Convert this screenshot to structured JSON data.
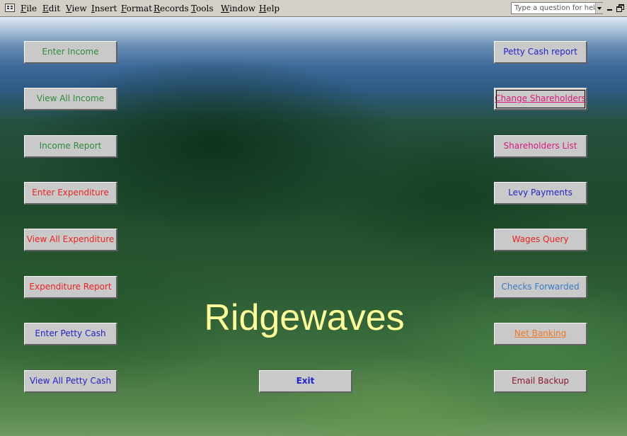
{
  "menubar": {
    "items": [
      "File",
      "Edit",
      "View",
      "Insert",
      "Format",
      "Records",
      "Tools",
      "Window",
      "Help"
    ],
    "help_placeholder": "Type a question for help"
  },
  "form": {
    "title": "Ridgewaves",
    "title_color": "#ffff99"
  },
  "buttons_left": [
    {
      "label": "Enter Income",
      "color": "#2e8b3a"
    },
    {
      "label": "View All Income",
      "color": "#2e8b3a"
    },
    {
      "label": "Income Report",
      "color": "#2e8b3a"
    },
    {
      "label": "Enter Expenditure",
      "color": "#ee2222"
    },
    {
      "label": "View All Expenditure",
      "color": "#ee2222"
    },
    {
      "label": "Expenditure Report",
      "color": "#ee2222"
    },
    {
      "label": "Enter Petty Cash",
      "color": "#2222cc"
    },
    {
      "label": "View All Petty Cash",
      "color": "#2222cc"
    }
  ],
  "buttons_right": [
    {
      "label": "Petty Cash report",
      "color": "#2222cc"
    },
    {
      "label": "Change Shareholders",
      "color": "#d81b7a"
    },
    {
      "label": "Shareholders List",
      "color": "#d81b7a"
    },
    {
      "label": "Levy Payments",
      "color": "#2222cc"
    },
    {
      "label": "Wages Query",
      "color": "#ee2222"
    },
    {
      "label": "Checks Forwarded",
      "color": "#3a7bc8"
    },
    {
      "label": "Net Banking",
      "color": "#ee7722"
    },
    {
      "label": "Email Backup",
      "color": "#8b1a2a"
    }
  ],
  "exit_button": {
    "label": "Exit",
    "color": "#2222cc"
  }
}
